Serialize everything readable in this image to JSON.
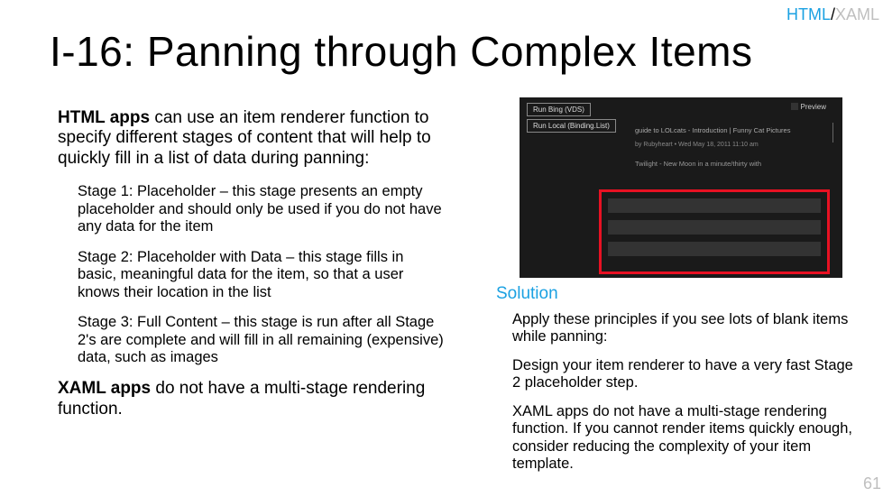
{
  "tag": {
    "html": "HTML",
    "sep": "/",
    "xaml": "XAML"
  },
  "title": "I-16: Panning through Complex Items",
  "intro": {
    "bold": "HTML apps",
    "rest": " can use an item renderer function to specify different stages of content that will help to quickly fill in a list of data during panning:"
  },
  "stages": [
    "Stage 1: Placeholder – this stage presents an empty placeholder and should only be used if you do not have any data for the item",
    "Stage 2: Placeholder with Data – this stage fills in basic, meaningful data for the item, so that a user knows their location in the list",
    "Stage 3: Full Content – this stage is run after all Stage 2's are complete and will fill in all remaining (expensive) data, such as images"
  ],
  "xamlNote": {
    "bold": "XAML apps",
    "rest": " do not have a multi-stage rendering function."
  },
  "solution": {
    "heading": "Solution",
    "items": [
      "Apply these principles if you see lots of blank items while panning:",
      "Design your item renderer to have a very fast Stage 2 placeholder step.",
      "XAML apps do not have a multi-stage rendering function. If you cannot render items quickly enough, consider reducing the complexity of your item template."
    ]
  },
  "shot": {
    "btn1": "Run Bing (VDS)",
    "btn2": "Run Local (Binding.List)",
    "preview": "Preview",
    "headline": "guide to LOLcats - Introduction | Funny Cat Pictures",
    "byline": "by Rubyheart • Wed May 18, 2011 11:10 am",
    "sub": "Twilight - New Moon in a minute/thirty with"
  },
  "slideNumber": "61"
}
